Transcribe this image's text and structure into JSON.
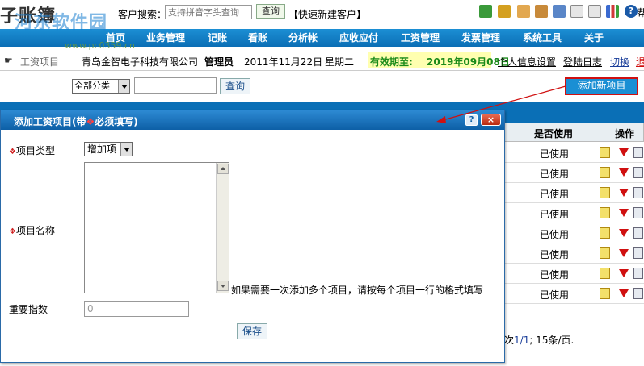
{
  "app": {
    "logo_text": "子账簿",
    "watermark": "河东软件园",
    "watermark_url": "www.pc0359.cn"
  },
  "topbar": {
    "search_label": "客户搜索：",
    "search_placeholder": "支持拼音字头查询",
    "search_button": "查询",
    "quick_add": "【快速新建客户】",
    "icons": [
      "add-user-icon",
      "user-icon",
      "folder-icon",
      "folder-open-icon",
      "mail-icon",
      "export-icon",
      "import-icon",
      "chart-icon",
      "help-icon"
    ],
    "help_text": "帮"
  },
  "nav": {
    "items": [
      "首页",
      "业务管理",
      "记账",
      "看账",
      "分析帐",
      "应收应付",
      "工资管理",
      "发票管理",
      "系统工具",
      "关于"
    ]
  },
  "info": {
    "breadcrumb": "工资项目",
    "company": "青岛金智电子科技有限公司",
    "role": "管理员",
    "date": "2011年11月22日",
    "weekday": "星期二",
    "validity_label": "有效期至:",
    "validity_date": "2019年09月08日",
    "links": [
      "个人信息设置",
      "登陆日志",
      "切换",
      "退"
    ]
  },
  "filter": {
    "category_select": "全部分类",
    "search_button": "查询",
    "add_new_button": "添加新项目"
  },
  "table": {
    "headers": [
      "是否使用",
      "操作"
    ],
    "rows": [
      "已使用",
      "已使用",
      "已使用",
      "已使用",
      "已使用",
      "已使用",
      "已使用",
      "已使用"
    ],
    "pager": {
      "prefix": "次",
      "page": "1/1",
      "suffix": "; 15条/页."
    }
  },
  "dialog": {
    "title_prefix": "添加工资项目(带",
    "title_mark": "❖",
    "title_suffix": "必须填写)",
    "help_button": "?",
    "close_button": "×",
    "required_mark": "❖",
    "type_label": "项目类型",
    "type_value": "增加项",
    "name_label": "项目名称",
    "name_hint": "如果需要一次添加多个项目，请按每个项目一行的格式填写",
    "weight_label": "重要指数",
    "weight_value": "0",
    "save_button": "保存"
  }
}
